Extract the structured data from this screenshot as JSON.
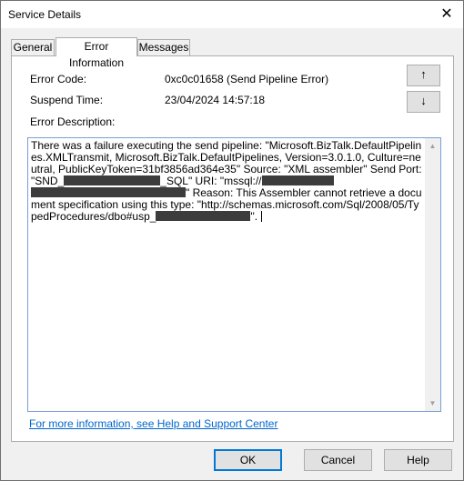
{
  "window": {
    "title": "Service Details",
    "close_glyph": "✕"
  },
  "tabs": [
    {
      "label": "General"
    },
    {
      "label": "Error Information"
    },
    {
      "label": "Messages"
    }
  ],
  "fields": {
    "error_code_label": "Error Code:",
    "error_code_value": "0xc0c01658 (Send Pipeline Error)",
    "suspend_time_label": "Suspend Time:",
    "suspend_time_value": "23/04/2024 14:57:18",
    "description_label": "Error Description:"
  },
  "nav": {
    "up_glyph": "↑",
    "down_glyph": "↓"
  },
  "description": {
    "p1": "There was a failure executing the send pipeline: \"Microsoft.BizTalk.DefaultPipelines.XMLTransmit, Microsoft.BizTalk.DefaultPipelines, Version=3.0.1.0, Culture=neutral, PublicKeyToken=31bf3856ad364e35\" Source: \"XML assembler\" Send Port: \"SND_",
    "p2": "_SQL\" URI: \"mssql://",
    "p3": "\" Reason: This Assembler cannot retrieve a document specification using this type: \"http://schemas.microsoft.com/Sql/2008/05/TypedProcedures/dbo#usp_",
    "p4": "\"."
  },
  "link": {
    "label": "For more information, see Help and Support Center"
  },
  "buttons": {
    "ok": "OK",
    "cancel": "Cancel",
    "help": "Help"
  },
  "colors": {
    "link": "#0066cc",
    "focus_border": "#0078d7",
    "redaction": "#3c3c3c"
  }
}
